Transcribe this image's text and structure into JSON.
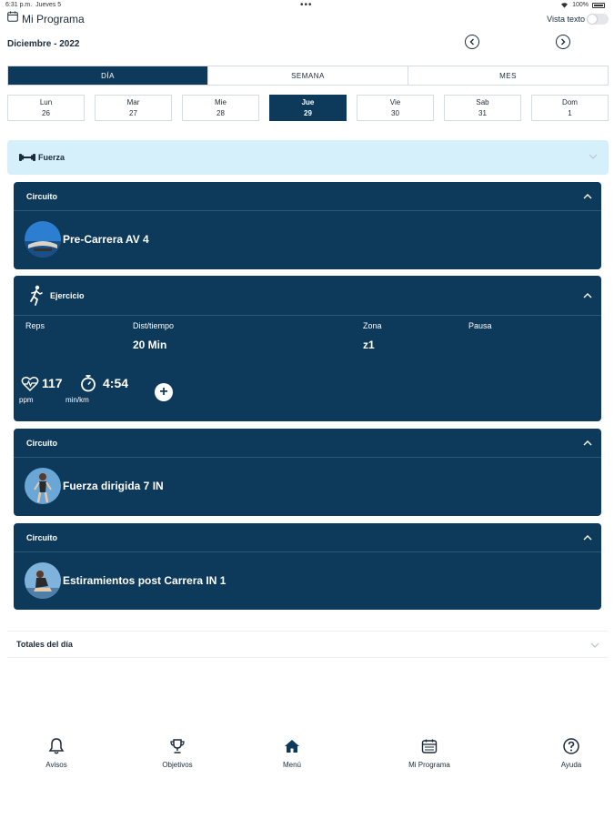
{
  "status": {
    "time": "6:31 p.m.",
    "date": "Jueves 5",
    "dots": "•••",
    "battery": "100%"
  },
  "header": {
    "title": "Mi Programa",
    "vista_label": "Vista texto"
  },
  "month": "Diciembre - 2022",
  "tabs": [
    {
      "label": "DÍA",
      "active": true
    },
    {
      "label": "SEMANA",
      "active": false
    },
    {
      "label": "MES",
      "active": false
    }
  ],
  "days": [
    {
      "name": "Lun",
      "num": "26"
    },
    {
      "name": "Mar",
      "num": "27"
    },
    {
      "name": "Mie",
      "num": "28"
    },
    {
      "name": "Jue",
      "num": "29",
      "active": true
    },
    {
      "name": "Vie",
      "num": "30"
    },
    {
      "name": "Sab",
      "num": "31"
    },
    {
      "name": "Dom",
      "num": "1"
    }
  ],
  "section": {
    "title": "Fuerza"
  },
  "cards": {
    "c1": {
      "header": "Circuito",
      "name": "Pre-Carrera AV 4"
    },
    "c2": {
      "header": "Ejercicio",
      "cols": {
        "reps": "Reps",
        "dist": "Dist/tiempo",
        "zona": "Zona",
        "pausa": "Pausa"
      },
      "values": {
        "dist": "20 Min",
        "zona": "z1"
      },
      "metrics": {
        "hr": "117",
        "hr_unit": "ppm",
        "pace": "4:54",
        "pace_unit": "min/km",
        "plus": "+"
      }
    },
    "c3": {
      "header": "Circuito",
      "name": "Fuerza dirigida 7 IN"
    },
    "c4": {
      "header": "Circuito",
      "name": "Estiramientos post Carrera IN 1"
    }
  },
  "totales": "Totales del día",
  "tabbar": [
    {
      "label": "Avisos",
      "icon": "bell-icon"
    },
    {
      "label": "Objetivos",
      "icon": "trophy-icon"
    },
    {
      "label": "Menú",
      "icon": "home-icon"
    },
    {
      "label": "Mi Programa",
      "icon": "calendar-icon"
    },
    {
      "label": "Ayuda",
      "icon": "help-icon"
    }
  ],
  "colors": {
    "primary": "#0d3a5b",
    "section_bg": "#d5f0fb",
    "text": "#1b2a3a"
  }
}
